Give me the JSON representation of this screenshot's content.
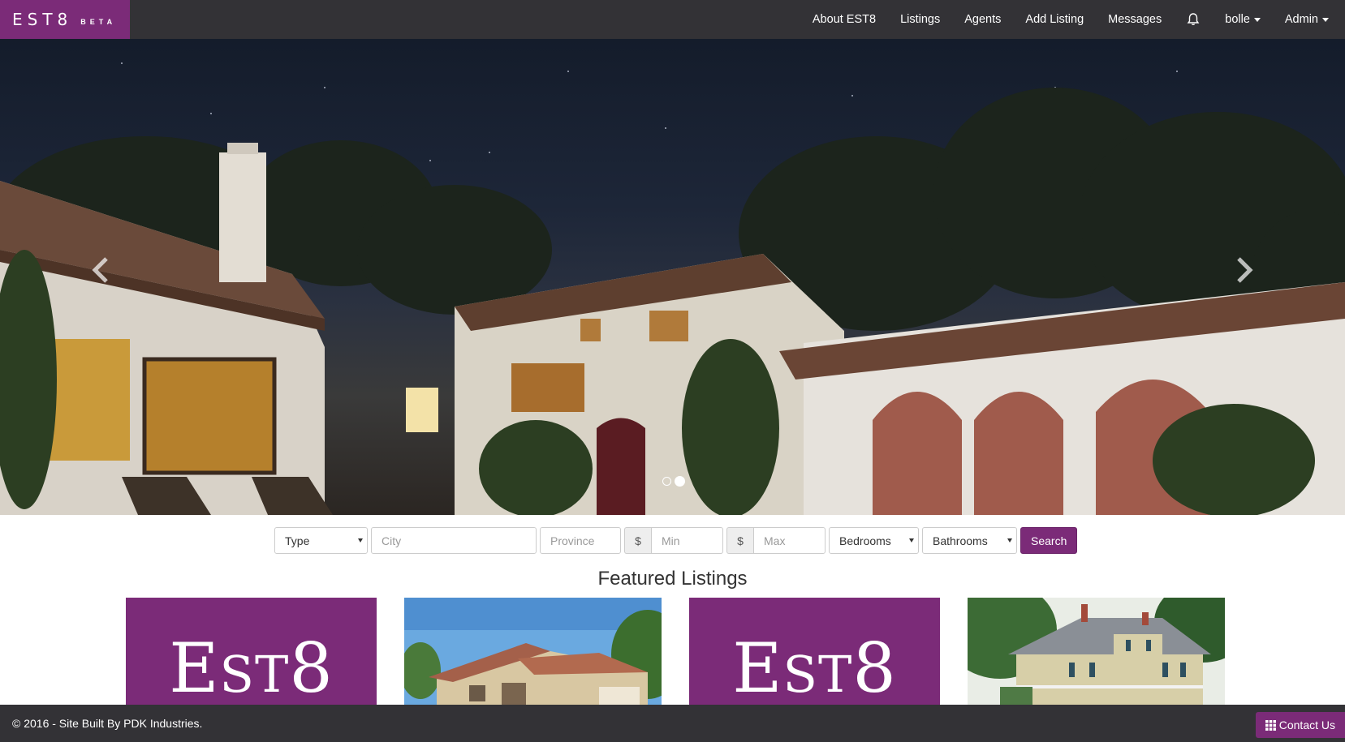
{
  "brand": {
    "name": "EST8",
    "tag": "BETA"
  },
  "nav": {
    "about": "About EST8",
    "listings": "Listings",
    "agents": "Agents",
    "add_listing": "Add Listing",
    "messages": "Messages",
    "user": "bolle",
    "admin": "Admin",
    "icons": {
      "notifications": "bell-icon",
      "dropdown": "caret-down-icon"
    }
  },
  "carousel": {
    "slide_count": 2,
    "active_slide": 2
  },
  "search": {
    "type_label": "Type",
    "city_placeholder": "City",
    "province_placeholder": "Province",
    "currency_symbol": "$",
    "min_placeholder": "Min",
    "max_placeholder": "Max",
    "bedrooms_label": "Bedrooms",
    "bathrooms_label": "Bathrooms",
    "button_label": "Search"
  },
  "featured": {
    "title": "Featured Listings",
    "listings": [
      {
        "kind": "logo",
        "logo_text": "EST8"
      },
      {
        "kind": "photo",
        "photo": "tan-stucco-house"
      },
      {
        "kind": "logo",
        "logo_text": "EST8"
      },
      {
        "kind": "photo",
        "photo": "colonial-house"
      }
    ]
  },
  "footer": {
    "copyright": "© 2016 - Site Built By PDK Industries.",
    "contact_label": "Contact Us"
  },
  "colors": {
    "brand": "#7b2b78",
    "navbar": "#333236"
  }
}
